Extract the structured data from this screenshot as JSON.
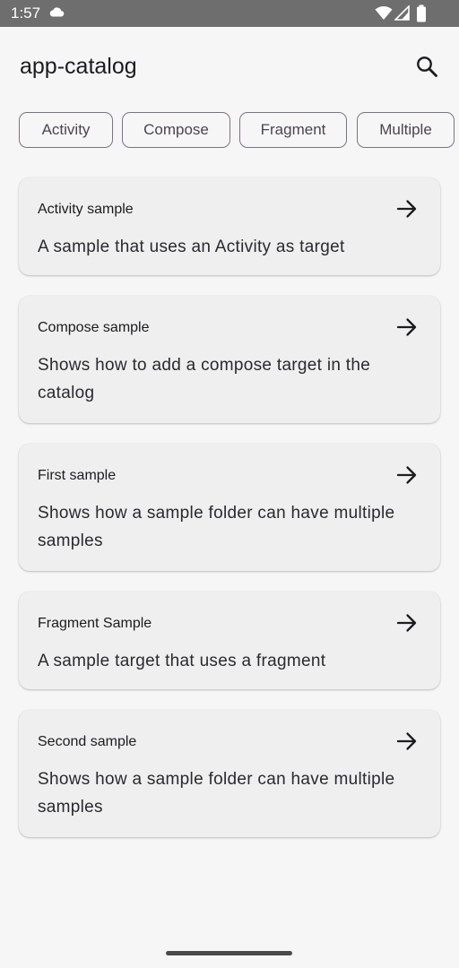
{
  "status_bar": {
    "time": "1:57",
    "icons": [
      "cloud-icon",
      "wifi-icon",
      "signal-icon",
      "battery-icon"
    ]
  },
  "app_bar": {
    "title": "app-catalog",
    "action_icon": "search-icon"
  },
  "filter_chips": [
    {
      "label": "Activity"
    },
    {
      "label": "Compose"
    },
    {
      "label": "Fragment"
    },
    {
      "label": "Multiple"
    }
  ],
  "samples": [
    {
      "title": "Activity sample",
      "description": "A sample that uses an Activity as target",
      "icon": "arrow-right-icon"
    },
    {
      "title": "Compose sample",
      "description": "Shows how to add a compose target in the catalog",
      "icon": "arrow-right-icon"
    },
    {
      "title": "First sample",
      "description": "Shows how a sample folder can have multiple samples",
      "icon": "arrow-right-icon"
    },
    {
      "title": "Fragment Sample",
      "description": "A sample target that uses a fragment",
      "icon": "arrow-right-icon"
    },
    {
      "title": "Second sample",
      "description": "Shows how a sample folder can have multiple samples",
      "icon": "arrow-right-icon"
    }
  ],
  "colors": {
    "background": "#f7f6f6",
    "status_bar": "#6e6e6e",
    "card": "#efefef",
    "chip_border": "#79747e",
    "text": "#1c1b1f"
  }
}
